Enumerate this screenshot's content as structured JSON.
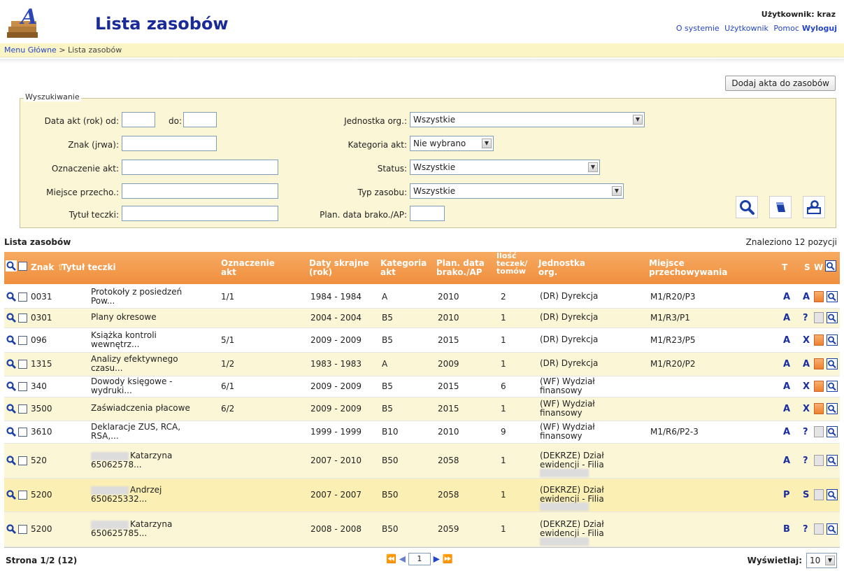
{
  "header": {
    "title": "Lista zasobów",
    "user_label": "Użytkownik: kraz",
    "links": {
      "about": "O systemie",
      "user": "Użytkownik",
      "help": "Pomoc",
      "logout": "Wyloguj"
    }
  },
  "breadcrumb": {
    "home": "Menu Główne",
    "separator": " > ",
    "current": "Lista zasobów"
  },
  "toolbar": {
    "add_label": "Dodaj akta do zasobów"
  },
  "search": {
    "legend": "Wyszukiwanie",
    "date_from_label": "Data akt (rok) od:",
    "date_to_label": "do:",
    "sign_label": "Znak (jrwa):",
    "mark_label": "Oznaczenie akt:",
    "place_label": "Miejsce przecho.:",
    "folder_title_label": "Tytuł teczki:",
    "org_unit_label": "Jednostka org.:",
    "org_unit_value": "Wszystkie",
    "category_label": "Kategoria akt:",
    "category_value": "Nie wybrano",
    "status_label": "Status:",
    "status_value": "Wszystkie",
    "type_label": "Typ zasobu:",
    "type_value": "Wszystkie",
    "disposal_label": "Plan. data brako./AP:"
  },
  "list": {
    "title": "Lista zasobów",
    "found": "Znaleziono 12 pozycji",
    "columns": {
      "sign": "Znak",
      "folder_title": "Tytuł teczki",
      "mark_1": "Oznaczenie",
      "mark_2": "akt",
      "dates_1": "Daty skrajne",
      "dates_2": "(rok)",
      "cat_1": "Kategoria",
      "cat_2": "akt",
      "plan_1": "Plan. data",
      "plan_2": "brako./AP",
      "count_1": "Ilość",
      "count_2": "teczek/",
      "count_3": "tomów",
      "unit_1": "Jednostka",
      "unit_2": "org.",
      "place_1": "Miejsce",
      "place_2": "przechowywania",
      "t": "T",
      "s": "S",
      "w": "W"
    },
    "rows": [
      {
        "sign": "0031",
        "title_1": "Protokoły z posiedzeń",
        "title_2": "Pow...",
        "mark": "1/1",
        "dates": "1984 - 1984",
        "cat": "A",
        "plan": "2010",
        "count": "2",
        "unit_1": "(DR) Dyrekcja",
        "unit_2": "",
        "place": "M1/R20/P3",
        "t": "A",
        "s": "A",
        "w": "on"
      },
      {
        "sign": "0301",
        "title_1": "Plany okresowe",
        "title_2": "",
        "mark": "",
        "dates": "2004 - 2004",
        "cat": "B5",
        "plan": "2010",
        "count": "1",
        "unit_1": "(DR) Dyrekcja",
        "unit_2": "",
        "place": "M1/R3/P1",
        "t": "A",
        "s": "?",
        "w": "off"
      },
      {
        "sign": "096",
        "title_1": "Książka kontroli",
        "title_2": "wewnętrz...",
        "mark": "5/1",
        "dates": "2009 - 2009",
        "cat": "B5",
        "plan": "2015",
        "count": "1",
        "unit_1": "(DR) Dyrekcja",
        "unit_2": "",
        "place": "M1/R23/P5",
        "t": "A",
        "s": "X",
        "w": "on"
      },
      {
        "sign": "1315",
        "title_1": "Analizy efektywnego",
        "title_2": "czasu...",
        "mark": "1/2",
        "dates": "1983 - 1983",
        "cat": "A",
        "plan": "2009",
        "count": "1",
        "unit_1": "(DR) Dyrekcja",
        "unit_2": "",
        "place": "M1/R20/P2",
        "t": "A",
        "s": "A",
        "w": "on"
      },
      {
        "sign": "340",
        "title_1": "Dowody księgowe -",
        "title_2": "wydruki...",
        "mark": "6/1",
        "dates": "2009 - 2009",
        "cat": "B5",
        "plan": "2015",
        "count": "6",
        "unit_1": "(WF) Wydział",
        "unit_2": "finansowy",
        "place": "",
        "t": "A",
        "s": "X",
        "w": "on"
      },
      {
        "sign": "3500",
        "title_1": "Zaświadczenia płacowe",
        "title_2": "",
        "mark": "6/2",
        "dates": "2009 - 2009",
        "cat": "B5",
        "plan": "2015",
        "count": "1",
        "unit_1": "(WF) Wydział",
        "unit_2": "finansowy",
        "place": "",
        "t": "A",
        "s": "X",
        "w": "on"
      },
      {
        "sign": "3610",
        "title_1": "Deklaracje ZUS, RCA,",
        "title_2": "RSA,...",
        "mark": "",
        "dates": "1999 - 1999",
        "cat": "B10",
        "plan": "2010",
        "count": "9",
        "unit_1": "(WF) Wydział",
        "unit_2": "finansowy",
        "place": "M1/R6/P2-3",
        "t": "A",
        "s": "?",
        "w": "off"
      },
      {
        "sign": "520",
        "title_1": "Katarzyna",
        "title_2": "65062578...",
        "mark": "",
        "dates": "2007 - 2010",
        "cat": "B50",
        "plan": "2058",
        "count": "1",
        "unit_1": "(DEKRZE) Dział",
        "unit_2": "ewidencji - Filia",
        "place": "",
        "t": "A",
        "s": "?",
        "w": "off"
      },
      {
        "sign": "5200",
        "title_1": "Andrzej",
        "title_2": "650625332...",
        "mark": "",
        "dates": "2007 - 2007",
        "cat": "B50",
        "plan": "2058",
        "count": "1",
        "unit_1": "(DEKRZE) Dział",
        "unit_2": "ewidencji - Filia",
        "place": "",
        "t": "P",
        "s": "S",
        "w": "off"
      },
      {
        "sign": "5200",
        "title_1": "Katarzyna",
        "title_2": "650625785...",
        "mark": "",
        "dates": "2008 - 2008",
        "cat": "B50",
        "plan": "2059",
        "count": "1",
        "unit_1": "(DEKRZE) Dział",
        "unit_2": "ewidencji - Filia",
        "place": "",
        "t": "B",
        "s": "?",
        "w": "off"
      }
    ]
  },
  "footer": {
    "page_info": "Strona 1/2 (12)",
    "page_value": "1",
    "per_page_label": "Wyświetlaj:",
    "per_page_value": "10"
  },
  "colors": {
    "header_orange": "#f08e3d",
    "highlight": "#fbf6d6",
    "title_blue": "#1b2a99"
  }
}
